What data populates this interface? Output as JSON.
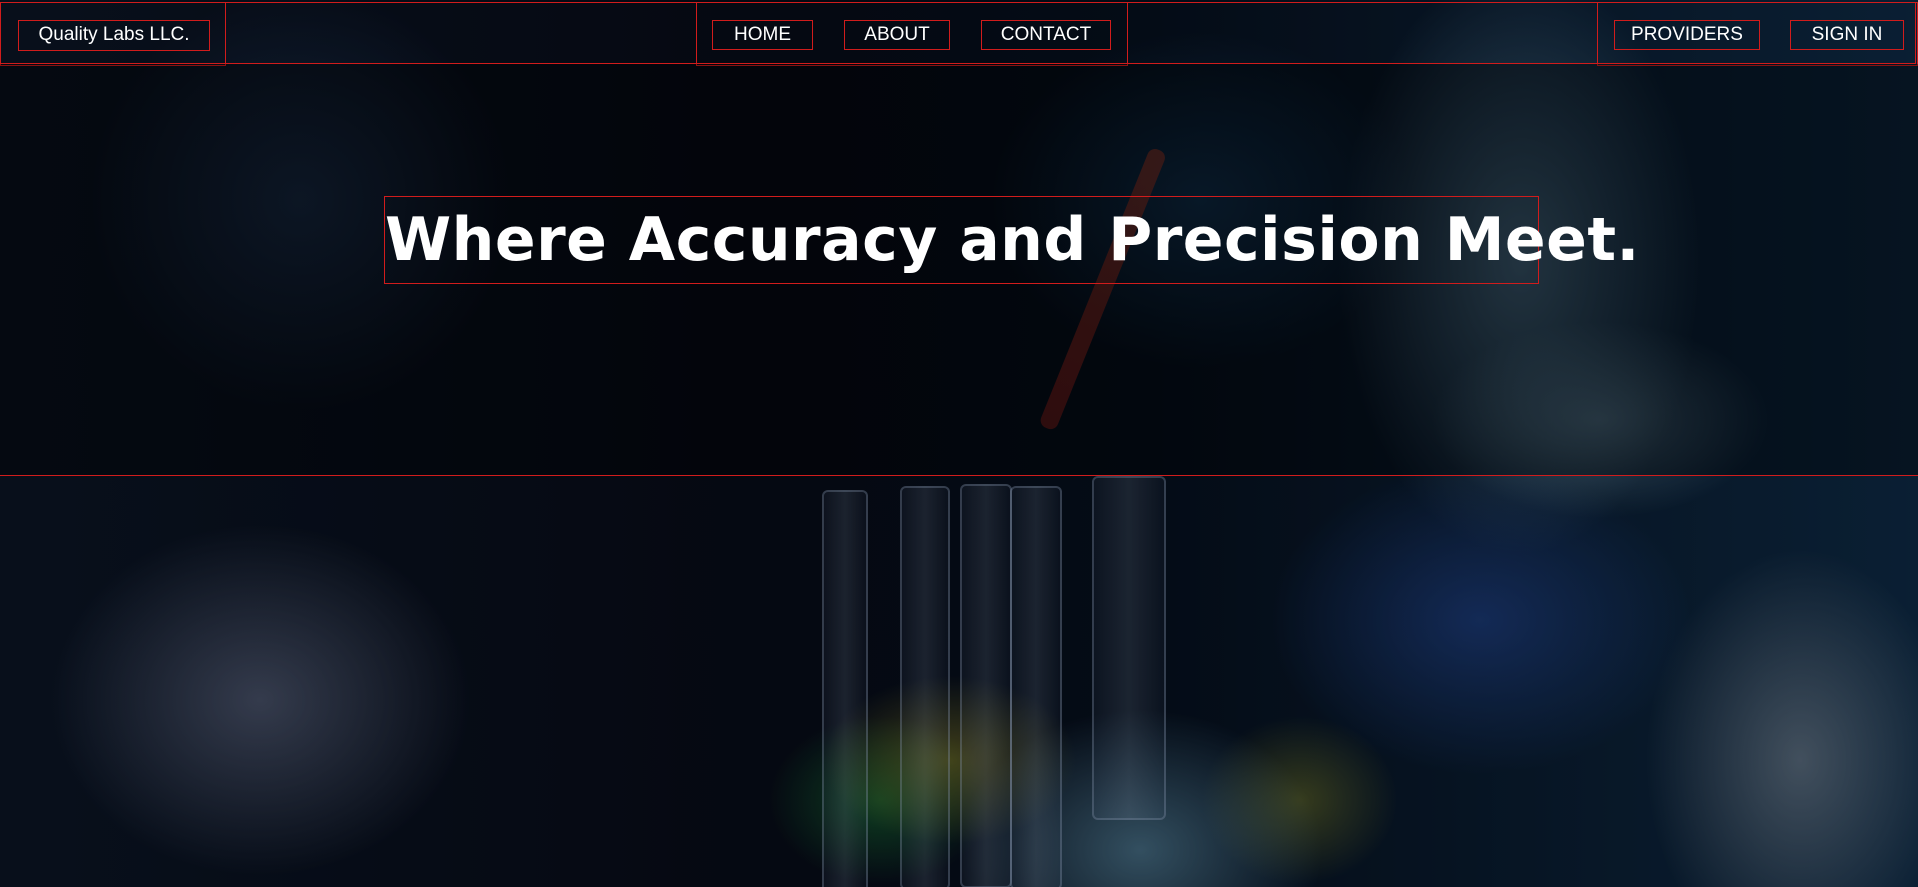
{
  "brand": {
    "name": "Quality Labs LLC."
  },
  "nav": {
    "links": [
      "HOME",
      "ABOUT",
      "CONTACT"
    ],
    "right_links": [
      "PROVIDERS",
      "SIGN IN"
    ]
  },
  "hero": {
    "headline": "Where Accuracy and Precision Meet."
  },
  "colors": {
    "outline": "#d11c1c",
    "text": "#ffffff",
    "background": "#050a14"
  }
}
